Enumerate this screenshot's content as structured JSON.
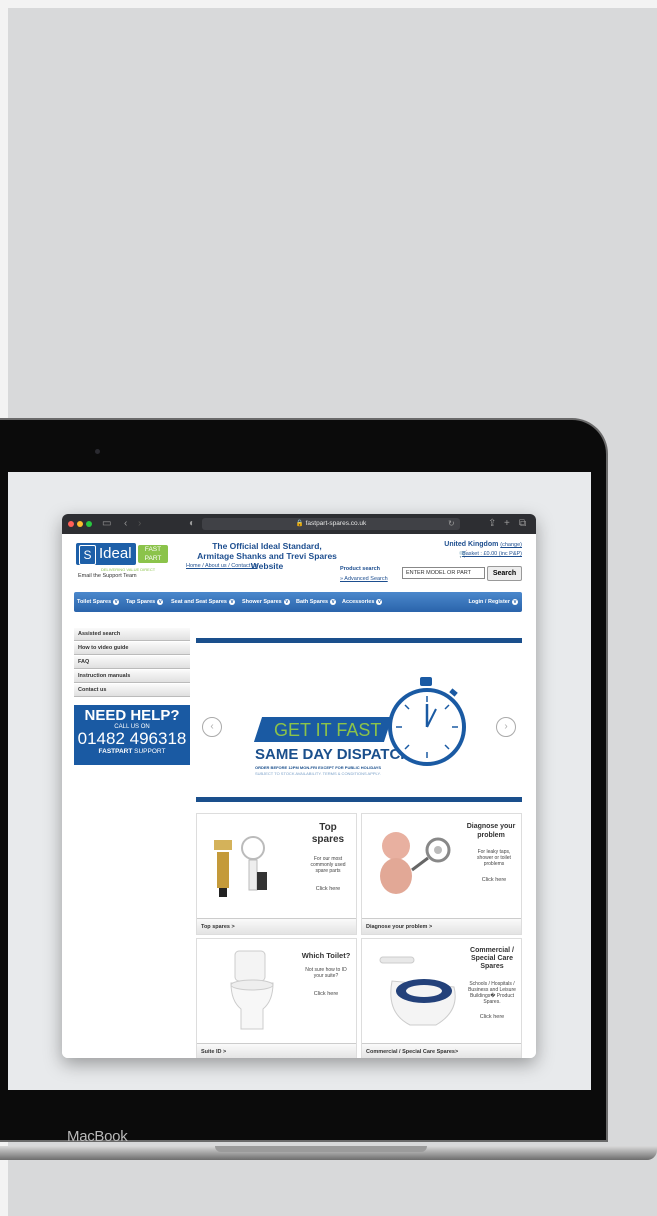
{
  "device": {
    "brand_label": "MacBook"
  },
  "browser": {
    "url": "fastpart-spares.co.uk"
  },
  "header": {
    "logo_main": "Ideal",
    "logo_fast": "FAST",
    "logo_part": "PART",
    "logo_tagline": "DELIVERING VALUE DIRECT",
    "email_team": "Email the Support Team",
    "site_title_line1": "The Official Ideal Standard,",
    "site_title_line2": "Armitage Shanks and Trevi Spares Website",
    "nav_home": "Home",
    "nav_about": "About us",
    "nav_contact": "Contact us",
    "country": "United Kingdom",
    "country_change": "(change)",
    "basket": "Basket : £0.00 (inc P&P)",
    "product_search_label": "Product search",
    "advanced_search": "» Advanced Search",
    "search_placeholder": "ENTER MODEL OR PART",
    "search_button": "Search"
  },
  "menu": {
    "items": [
      "Toilet Spares",
      "Tap Spares",
      "Seat and Seat Spares",
      "Shower Spares",
      "Bath Spares",
      "Accessories"
    ],
    "login": "Login / Register"
  },
  "sidebar": {
    "items": [
      "Assisted search",
      "How to video guide",
      "FAQ",
      "Instruction manuals",
      "Contact us"
    ],
    "help_title": "NEED HELP?",
    "help_call": "CALL US ON",
    "help_phone": "01482 496318",
    "help_support_1": "FASTPART",
    "help_support_2": "SUPPORT"
  },
  "banner": {
    "headline": "GET IT FAST",
    "subheadline": "SAME DAY DISPATCH",
    "line1": "ORDER BEFORE 12PM MON-FRI EXCEPT FOR PUBLIC HOLIDAYS",
    "line2": "SUBJECT TO STOCK AVAILABILITY. TERMS & CONDITIONS APPLY."
  },
  "tiles": [
    {
      "title_1": "Top",
      "title_2": "spares",
      "desc": "For our most commonly used spare parts",
      "click": "Click here",
      "footer": "Top spares >"
    },
    {
      "title_1": "Diagnose your",
      "title_2": "problem",
      "desc": "For leaky taps, shower or toilet problems",
      "click": "Click here",
      "footer": "Diagnose your problem >"
    },
    {
      "title_1": "Which Toilet?",
      "title_2": "",
      "desc": "Not sure how to ID your suite?",
      "click": "Click here",
      "footer": "Suite ID >"
    },
    {
      "title_1": "Commercial /",
      "title_2": "Special Care Spares",
      "desc": "Schools / Hospitals / Business and Leisure Buildings� Product Spares.",
      "click": "Click here",
      "footer": "Commercial / Special Care Spares>"
    }
  ],
  "colors": {
    "brand_blue": "#1a5aa3",
    "brand_green": "#8bc34a",
    "menu_blue": "#3577bf"
  }
}
